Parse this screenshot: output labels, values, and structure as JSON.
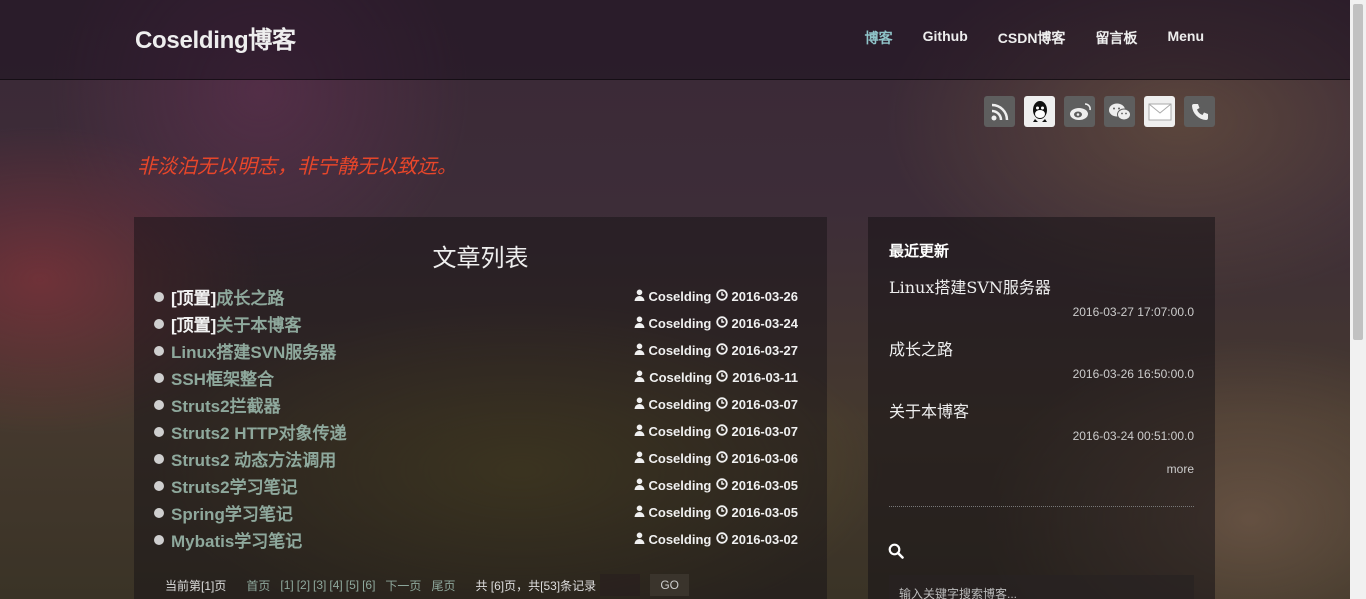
{
  "brand": "Coselding博客",
  "nav": [
    "博客",
    "Github",
    "CSDN博客",
    "留言板",
    "Menu"
  ],
  "social": [
    "rss-icon",
    "qq-icon",
    "weibo-icon",
    "wechat-icon",
    "mail-icon",
    "phone-icon"
  ],
  "motto": "非淡泊无以明志，非宁静无以致远。",
  "main": {
    "title": "文章列表",
    "articles": [
      {
        "prefix": "[顶置]",
        "title": "成长之路",
        "author": "Coselding",
        "date": "2016-03-26"
      },
      {
        "prefix": "[顶置]",
        "title": "关于本博客",
        "author": "Coselding",
        "date": "2016-03-24"
      },
      {
        "prefix": "",
        "title": "Linux搭建SVN服务器",
        "author": "Coselding",
        "date": "2016-03-27"
      },
      {
        "prefix": "",
        "title": "SSH框架整合",
        "author": "Coselding",
        "date": "2016-03-11"
      },
      {
        "prefix": "",
        "title": "Struts2拦截器",
        "author": "Coselding",
        "date": "2016-03-07"
      },
      {
        "prefix": "",
        "title": "Struts2 HTTP对象传递",
        "author": "Coselding",
        "date": "2016-03-07"
      },
      {
        "prefix": "",
        "title": "Struts2 动态方法调用",
        "author": "Coselding",
        "date": "2016-03-06"
      },
      {
        "prefix": "",
        "title": "Struts2学习笔记",
        "author": "Coselding",
        "date": "2016-03-05"
      },
      {
        "prefix": "",
        "title": "Spring学习笔记",
        "author": "Coselding",
        "date": "2016-03-05"
      },
      {
        "prefix": "",
        "title": "Mybatis学习笔记",
        "author": "Coselding",
        "date": "2016-03-02"
      }
    ],
    "pager": {
      "current": "当前第[1]页",
      "first": "首页",
      "pages": [
        "[1]",
        "[2]",
        "[3]",
        "[4]",
        "[5]",
        "[6]"
      ],
      "next": "下一页",
      "last": "尾页",
      "summary": "共 [6]页，共[53]条记录",
      "go": "GO"
    }
  },
  "side": {
    "heading": "最近更新",
    "recent": [
      {
        "title": "Linux搭建SVN服务器",
        "time": "2016-03-27 17:07:00.0"
      },
      {
        "title": "成长之路",
        "time": "2016-03-26 16:50:00.0"
      },
      {
        "title": "关于本博客",
        "time": "2016-03-24 00:51:00.0"
      }
    ],
    "more": "more",
    "search_placeholder": "输入关键字搜索博客..."
  },
  "colors": {
    "accent": "#8fc3c8",
    "motto": "#e7462a",
    "link": "#8ea89c"
  }
}
